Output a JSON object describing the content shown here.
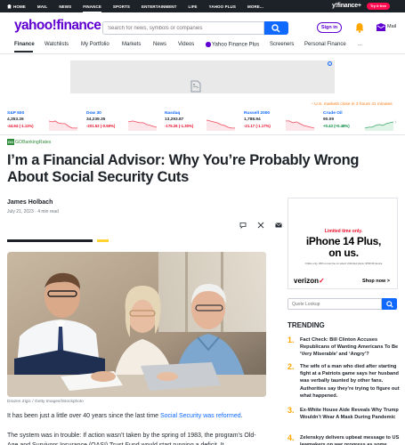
{
  "topnav": {
    "links": [
      "HOME",
      "MAIL",
      "NEWS",
      "FINANCE",
      "SPORTS",
      "ENTERTAINMENT",
      "LIFE",
      "YAHOO PLUS",
      "MORE..."
    ],
    "active": "FINANCE",
    "brand_right": "y!finance+",
    "try_free": "Try it free"
  },
  "header": {
    "logo": "yahoo!finance",
    "search_placeholder": "Search for news, symbols or companies",
    "sign_in": "Sign in",
    "mail": "Mail"
  },
  "subnav": {
    "items": [
      "Finance",
      "Watchlists",
      "My Portfolio",
      "Markets",
      "News",
      "Videos",
      "Yahoo Finance Plus",
      "Screeners",
      "Personal Finance",
      "..."
    ],
    "active": "Finance"
  },
  "market_note": "U.S. markets close in 3 hours 41 minutes",
  "ticker": [
    {
      "name": "S&P 500",
      "value": "4,353.26",
      "change": "-44.94 (-1.11%)",
      "direction": "neg"
    },
    {
      "name": "Dow 30",
      "value": "34,239.35",
      "change": "-201.53 (-0.59%)",
      "direction": "neg"
    },
    {
      "name": "Nasdaq",
      "value": "13,293.87",
      "change": "-175.26 (-1.30%)",
      "direction": "neg"
    },
    {
      "name": "Russell 2000",
      "value": "1,788.94",
      "change": "-21.17 (-1.17%)",
      "direction": "neg"
    },
    {
      "name": "Crude Oil",
      "value": "90.09",
      "change": "+0.43 (+0.48%)",
      "direction": "pos"
    }
  ],
  "article": {
    "publisher_logo": "GO",
    "publisher": "GOBankingRates",
    "headline": "I’m a Financial Advisor: Why You’re Probably Wrong About Social Security Cuts",
    "author": "James Holbach",
    "date": "July 21, 2023",
    "read_time": "4 min read",
    "caption": "Drazen Zigic / Getty Images/iStockphoto",
    "para1_before": "It has been just a little over 40 years since the last time ",
    "para1_link": "Social Security was reformed",
    "para1_after": ".",
    "para2": "The system was in trouble: If action wasn’t taken by the spring of 1983, the program’s Old-Age and Survivors Insurance (OASI) Trust Fund would start running a deficit. It"
  },
  "right_ad": {
    "limited": "Limited time only.",
    "headline_line1": "iPhone 14 Plus,",
    "headline_line2": "on us.",
    "fine_print": "Online only. With a new line on select Unlimited plans. $799.99 device",
    "brand": "verizon",
    "cta": "Shop now >"
  },
  "quote_lookup": {
    "placeholder": "Quote Lookup"
  },
  "trending": {
    "title": "TRENDING",
    "items": [
      {
        "num": "1.",
        "text": "Fact Check: Bill Clinton Accuses Republicans of Wanting Americans To Be ‘Very Miserable’ and ‘Angry’?"
      },
      {
        "num": "2.",
        "text": "The wife of a man who died after starting fight at a Patriots game says her husband was verbally taunted by other fans. Authorities say they’re trying to figure out what happened."
      },
      {
        "num": "3.",
        "text": "Ex-White House Aide Reveals Why Trump Wouldn’t Wear A Mask During Pandemic"
      },
      {
        "num": "4.",
        "text": "Zelenskyy delivers upbeat message to US lawmakers on war progress as some"
      }
    ]
  },
  "colors": {
    "brand_purple": "#6001d2",
    "link_blue": "#0f69ff",
    "negative": "#eb0f29",
    "positive": "#008a3e",
    "trending_num": "#ffa700"
  }
}
